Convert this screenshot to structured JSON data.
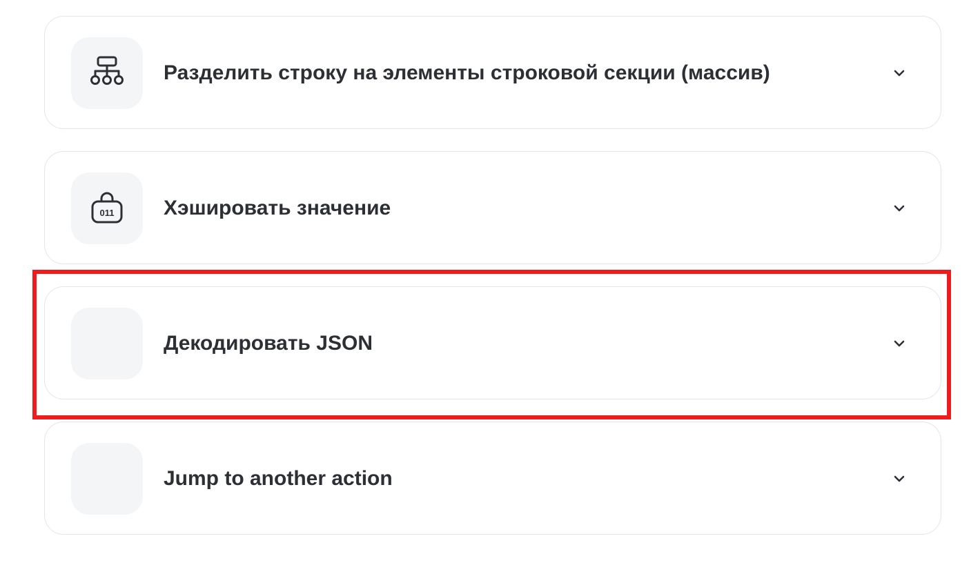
{
  "actions": [
    {
      "label": "Разделить строку на элементы строковой секции (массив)",
      "icon": "split-array-icon"
    },
    {
      "label": "Хэшировать значение",
      "icon": "hash-bag-icon",
      "icon_text": "011"
    },
    {
      "label": "Декодировать JSON",
      "icon": ""
    },
    {
      "label": "Jump to another action",
      "icon": ""
    }
  ],
  "expand_icon": "chevron-down-icon",
  "highlight": {
    "color": "#ee1c1c",
    "target": "Декодировать JSON"
  }
}
